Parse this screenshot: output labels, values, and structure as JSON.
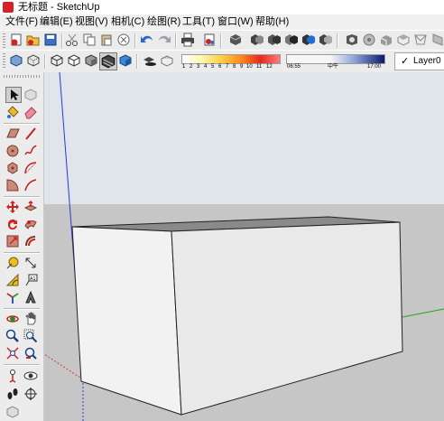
{
  "window": {
    "title": "无标题 - SketchUp"
  },
  "menu": [
    "文件(F)",
    "编辑(E)",
    "视图(V)",
    "相机(C)",
    "绘图(R)",
    "工具(T)",
    "窗口(W)",
    "帮助(H)"
  ],
  "shadow": {
    "months": [
      "1",
      "2",
      "3",
      "4",
      "5",
      "6",
      "7",
      "8",
      "9",
      "10",
      "11",
      "12"
    ],
    "time_start": "06:55",
    "time_mid": "中午",
    "time_end": "17:00"
  },
  "layer": {
    "check": "✓",
    "name": "Layer0"
  },
  "colors": {
    "sky": "#dfe5ea",
    "ground": "#c6c6c6",
    "box_front": "#f2f2f2",
    "box_side": "#e9e9e9",
    "box_top": "#8a8a8a",
    "axis_red": "#e0352f",
    "axis_green": "#1aa81a",
    "axis_blue": "#2a3ad8"
  },
  "toolbar1_icons": [
    "new-icon",
    "open-icon",
    "save-icon",
    "cut-icon",
    "copy-icon",
    "paste-icon",
    "erase-icon",
    "undo-icon",
    "redo-icon",
    "print-icon",
    "model-info-icon",
    "component-icon",
    "make-group-icon",
    "outer-shell-icon",
    "intersect-icon",
    "union-icon",
    "subtract-icon",
    "trim-icon",
    "split-icon",
    "view-iso-icon",
    "view-top-icon",
    "view-front-icon",
    "view-right-icon",
    "view-back-icon"
  ],
  "toolbar2_icons": [
    "xray-icon",
    "back-edges-icon",
    "wireframe-icon",
    "hidden-line-icon",
    "shaded-icon",
    "shaded-texture-icon",
    "monochrome-icon",
    "shadow-toggle-icon",
    "fog-icon"
  ],
  "left_tools": [
    "select-icon",
    "component-tool-icon",
    "paint-bucket-icon",
    "eraser-icon",
    "rectangle-icon",
    "line-icon",
    "circle-icon",
    "arc-icon",
    "polygon-icon",
    "freehand-icon",
    "pie-icon",
    "arc2-icon",
    "move-icon",
    "push-pull-icon",
    "rotate-icon",
    "follow-me-icon",
    "scale-icon",
    "offset-icon",
    "tape-measure-icon",
    "dimension-icon",
    "protractor-icon",
    "text-icon",
    "axes-icon",
    "3d-text-icon",
    "orbit-icon",
    "pan-icon",
    "zoom-icon",
    "zoom-window-icon",
    "zoom-extents-icon",
    "previous-view-icon",
    "position-camera-icon",
    "look-around-icon",
    "walk-icon",
    "section-plane-icon"
  ]
}
